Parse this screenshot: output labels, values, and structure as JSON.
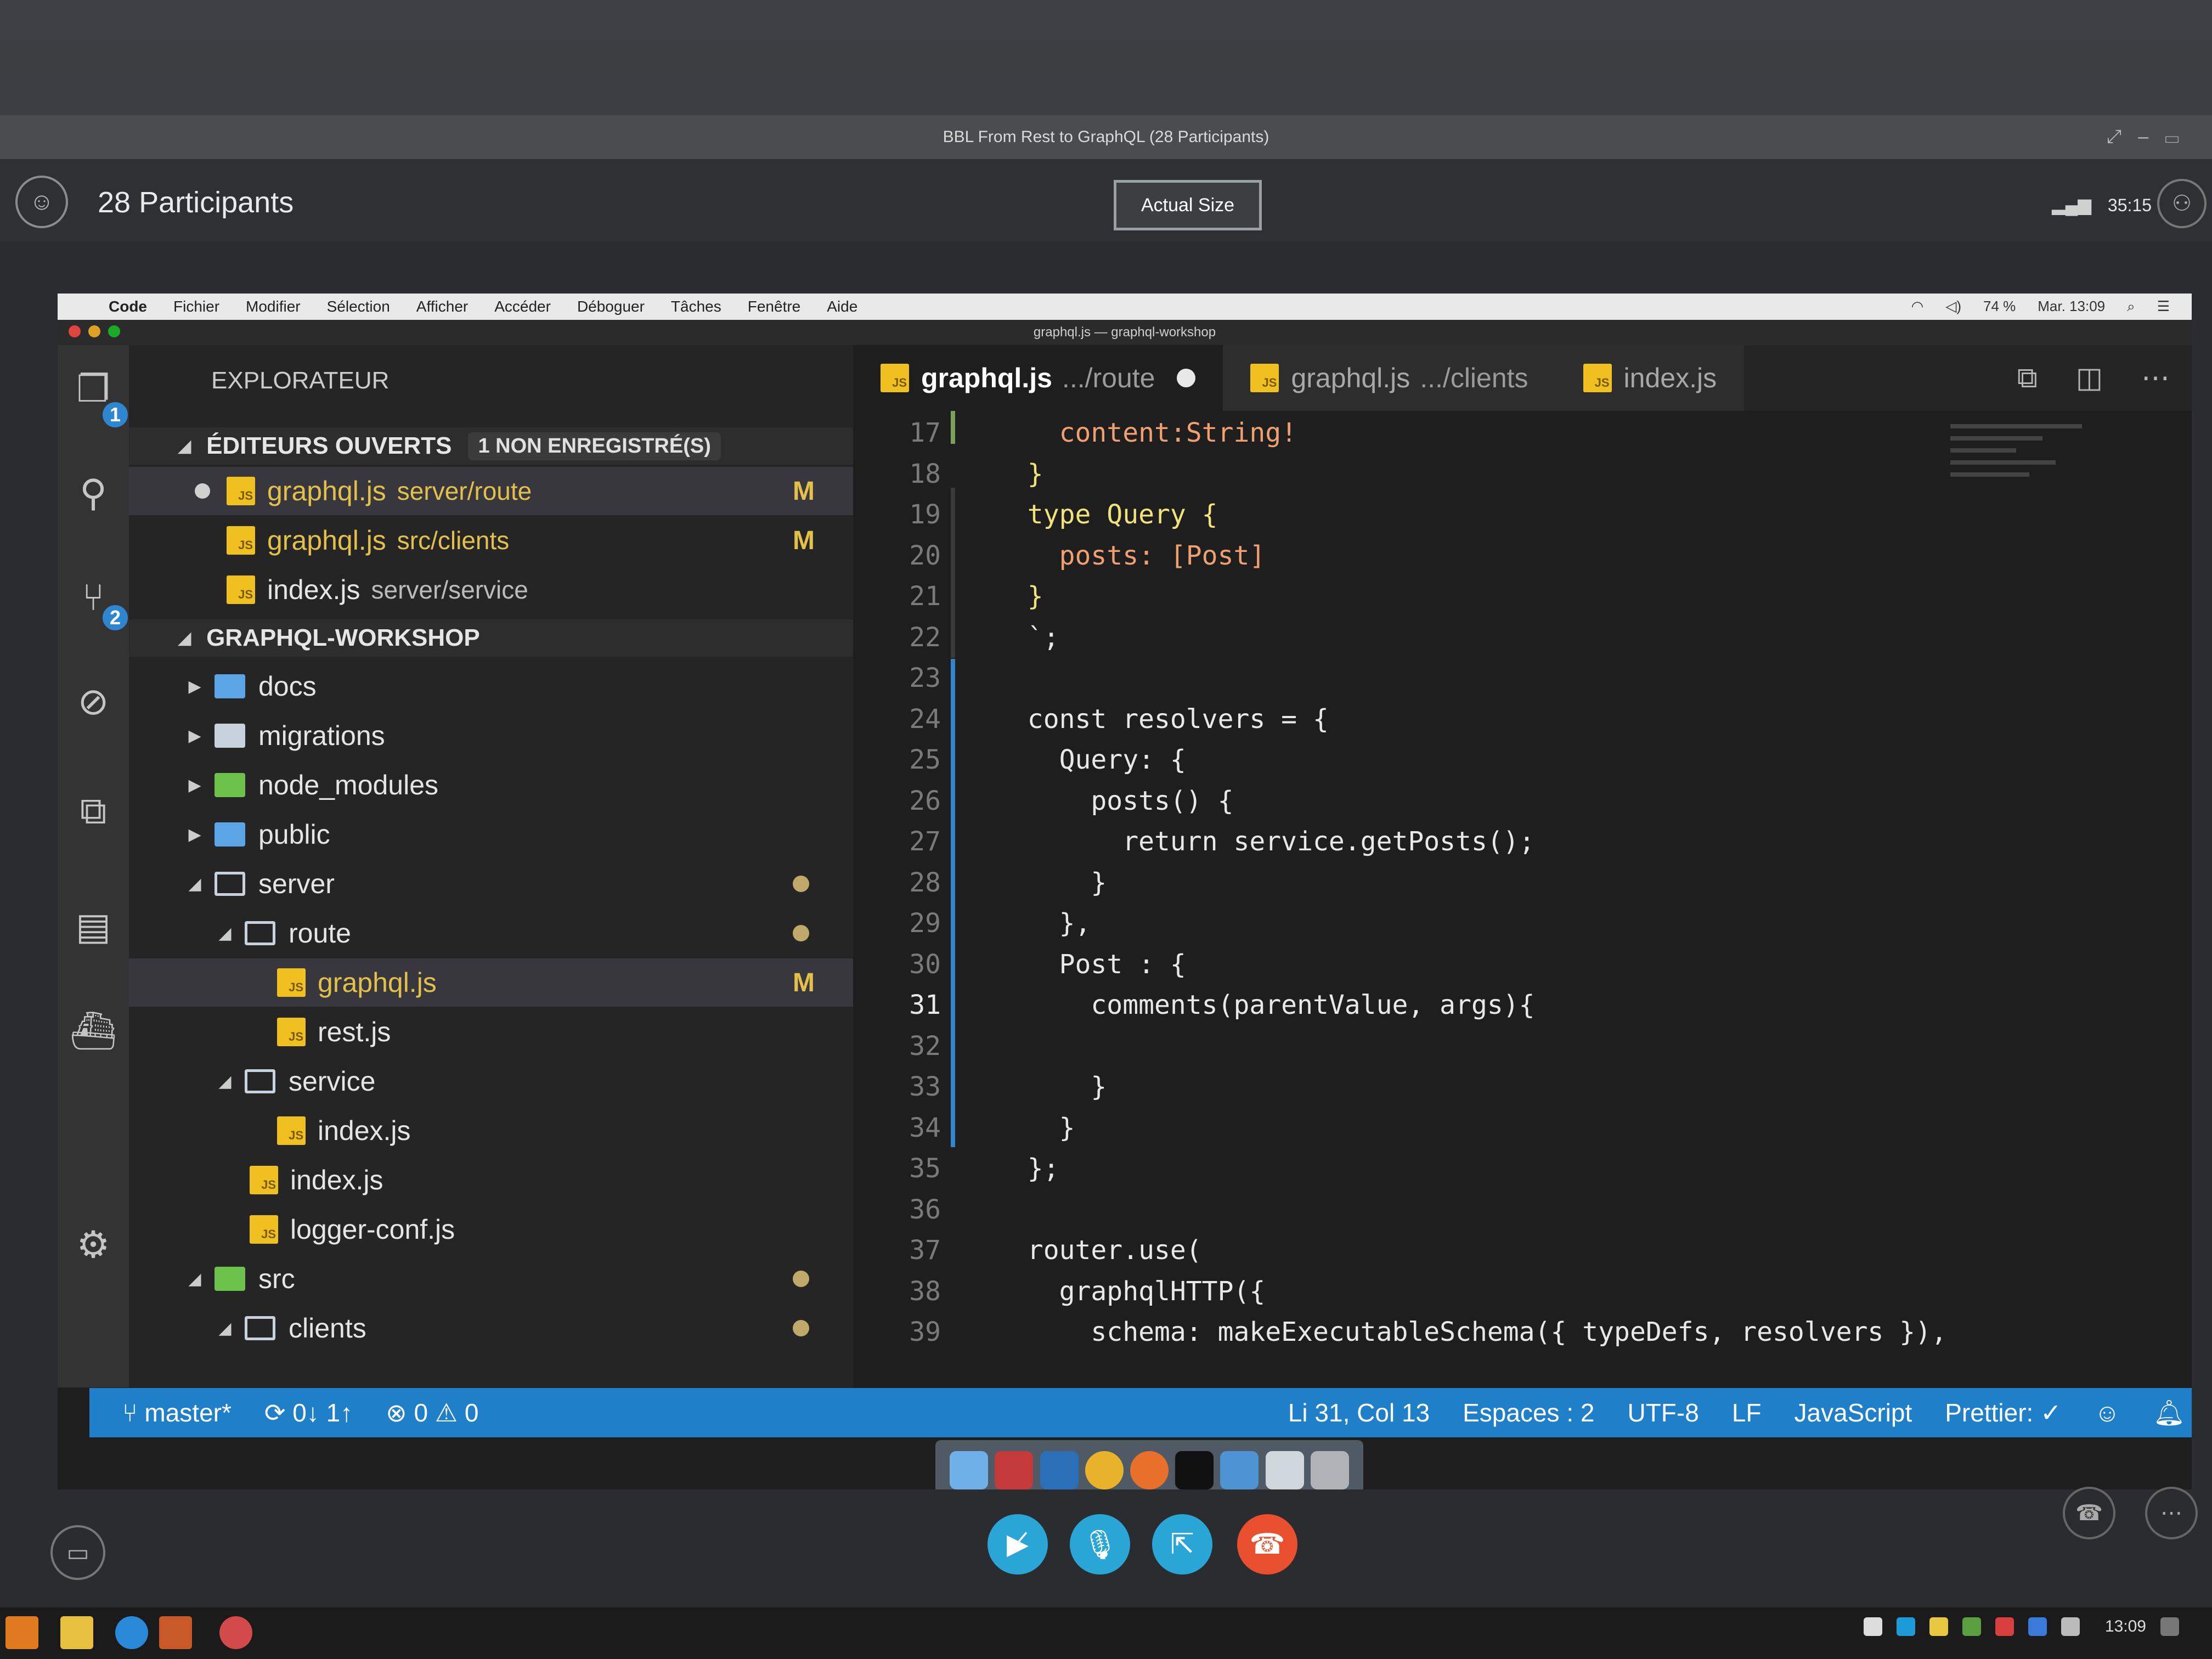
{
  "webex": {
    "window_title": "BBL From Rest to GraphQL (28 Participants)",
    "participants_label": "28 Participants",
    "actual_size_label": "Actual Size",
    "timer": "35:15"
  },
  "mac": {
    "menu": [
      "Code",
      "Fichier",
      "Modifier",
      "Sélection",
      "Afficher",
      "Accéder",
      "Déboguer",
      "Tâches",
      "Fenêtre",
      "Aide"
    ],
    "battery": "74 %",
    "clock": "Mar. 13:09",
    "window_title": "graphql.js — graphql-workshop"
  },
  "activity": {
    "explorer_badge": "1",
    "scm_badge": "2"
  },
  "sidebar": {
    "title": "EXPLORATEUR",
    "open_editors_label": "ÉDITEURS OUVERTS",
    "unsaved_label": "1 NON ENREGISTRÉ(S)",
    "open_editors": [
      {
        "name": "graphql.js",
        "path": "server/route",
        "flag": "M"
      },
      {
        "name": "graphql.js",
        "path": "src/clients",
        "flag": "M"
      },
      {
        "name": "index.js",
        "path": "server/service",
        "flag": ""
      }
    ],
    "workspace_label": "GRAPHQL-WORKSHOP",
    "tree": [
      {
        "name": "docs"
      },
      {
        "name": "migrations"
      },
      {
        "name": "node_modules"
      },
      {
        "name": "public"
      },
      {
        "name": "server"
      },
      {
        "name": "route"
      },
      {
        "name": "graphql.js",
        "flag": "M"
      },
      {
        "name": "rest.js"
      },
      {
        "name": "service"
      },
      {
        "name": "index.js"
      },
      {
        "name": "index.js"
      },
      {
        "name": "logger-conf.js"
      },
      {
        "name": "src"
      },
      {
        "name": "clients"
      }
    ]
  },
  "tabs": [
    {
      "name": "graphql.js",
      "path": ".../route"
    },
    {
      "name": "graphql.js",
      "path": ".../clients"
    },
    {
      "name": "index.js",
      "path": ""
    }
  ],
  "editor": {
    "lines": [
      {
        "n": "17",
        "text": "    content:String!"
      },
      {
        "n": "18",
        "text": "  }"
      },
      {
        "n": "19",
        "text": "  type Query {"
      },
      {
        "n": "20",
        "text": "    posts: [Post]"
      },
      {
        "n": "21",
        "text": "  }"
      },
      {
        "n": "22",
        "text": "  `;"
      },
      {
        "n": "23",
        "text": ""
      },
      {
        "n": "24",
        "text": "  const resolvers = {"
      },
      {
        "n": "25",
        "text": "    Query: {"
      },
      {
        "n": "26",
        "text": "      posts() {"
      },
      {
        "n": "27",
        "text": "        return service.getPosts();"
      },
      {
        "n": "28",
        "text": "      }"
      },
      {
        "n": "29",
        "text": "    },"
      },
      {
        "n": "30",
        "text": "    Post : {"
      },
      {
        "n": "31",
        "text": "      comments(parentValue, args){"
      },
      {
        "n": "32",
        "text": ""
      },
      {
        "n": "33",
        "text": "      }"
      },
      {
        "n": "34",
        "text": "    }"
      },
      {
        "n": "35",
        "text": "  };"
      },
      {
        "n": "36",
        "text": ""
      },
      {
        "n": "37",
        "text": "  router.use("
      },
      {
        "n": "38",
        "text": "    graphqlHTTP({"
      },
      {
        "n": "39",
        "text": "      schema: makeExecutableSchema({ typeDefs, resolvers }),"
      }
    ]
  },
  "status": {
    "branch": "master*",
    "sync": "0↓ 1↑",
    "errors": "0",
    "warnings": "0",
    "position": "Li 31, Col 13",
    "spaces": "Espaces : 2",
    "encoding": "UTF-8",
    "eol": "LF",
    "language": "JavaScript",
    "prettier": "Prettier: ✓"
  },
  "taskbar": {
    "clock": "13:09"
  },
  "colors": {
    "accent": "#1f7fc8",
    "js_badge": "#f0c020",
    "modified": "#e2c04a",
    "end_call": "#e8502f"
  }
}
